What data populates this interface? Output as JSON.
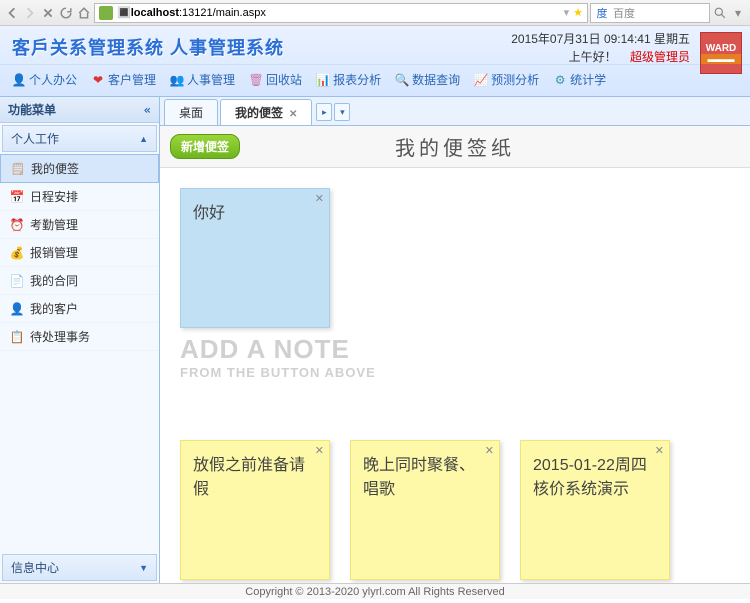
{
  "browser": {
    "url_host": "localhost",
    "url_rest": ":13121/main.aspx",
    "search_placeholder": "百度"
  },
  "header": {
    "app_title": "客戶关系管理系统 人事管理系统",
    "datetime": "2015年07月31日 09:14:41 星期五",
    "greeting": "上午好！",
    "role": "超级管理员",
    "ward": "WARD"
  },
  "nav": [
    {
      "label": "个人办公",
      "color": "#e08b1e"
    },
    {
      "label": "客户管理",
      "color": "#d33"
    },
    {
      "label": "人事管理",
      "color": "#2a8"
    },
    {
      "label": "回收站",
      "color": "#c7a"
    },
    {
      "label": "报表分析",
      "color": "#c33"
    },
    {
      "label": "数据查询",
      "color": "#37c"
    },
    {
      "label": "预测分析",
      "color": "#e6a"
    },
    {
      "label": "统计学",
      "color": "#39a"
    }
  ],
  "sidebar": {
    "panel_title": "功能菜单",
    "section1": "个人工作",
    "items": [
      {
        "label": "我的便签"
      },
      {
        "label": "日程安排"
      },
      {
        "label": "考勤管理"
      },
      {
        "label": "报销管理"
      },
      {
        "label": "我的合同"
      },
      {
        "label": "我的客户"
      },
      {
        "label": "待处理事务"
      }
    ],
    "info_center": "信息中心"
  },
  "tabs": {
    "tab1": "桌面",
    "tab2": "我的便签"
  },
  "content": {
    "new_note_btn": "新增便签",
    "page_title": "我的便签纸",
    "placeholder_l1": "ADD A NOTE",
    "placeholder_l2": "FROM THE BUTTON ABOVE",
    "notes": {
      "blue1": "你好",
      "y1": "放假之前准备请假",
      "y2": "晚上同时聚餐、唱歌",
      "y3": "2015-01-22周四 核价系统演示"
    }
  },
  "footer": "Copyright © 2013-2020 ylyrl.com All Rights Reserved"
}
